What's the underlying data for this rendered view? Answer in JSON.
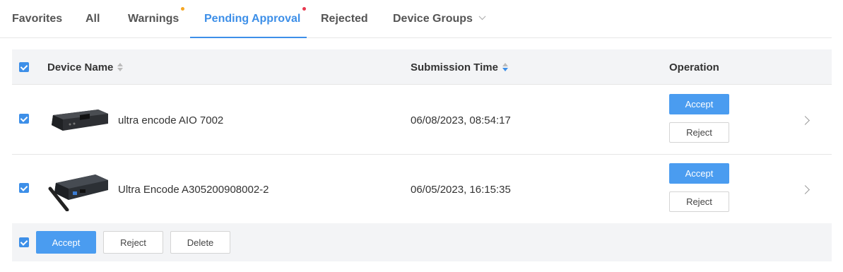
{
  "tabs": [
    {
      "label": "Favorites"
    },
    {
      "label": "All"
    },
    {
      "label": "Warnings"
    },
    {
      "label": "Pending Approval"
    },
    {
      "label": "Rejected"
    },
    {
      "label": "Device Groups"
    }
  ],
  "tab_colors": {
    "active": "#3d8fe8",
    "warning_dot": "#f5a623",
    "pending_dot": "#e8384f"
  },
  "table": {
    "headers": {
      "device_name": "Device Name",
      "submission_time": "Submission Time",
      "operation": "Operation"
    },
    "rows": [
      {
        "device_name": "ultra encode AIO 7002",
        "submission_time": "06/08/2023, 08:54:17",
        "accept": "Accept",
        "reject": "Reject",
        "selected": true
      },
      {
        "device_name": "Ultra Encode A305200908002-2",
        "submission_time": "06/05/2023, 16:15:35",
        "accept": "Accept",
        "reject": "Reject",
        "selected": true
      }
    ]
  },
  "footer": {
    "accept": "Accept",
    "reject": "Reject",
    "delete": "Delete"
  },
  "icons": {
    "sort": "sort-icon",
    "chevron_right": "chevron-right-icon",
    "chevron_down": "chevron-down-icon"
  }
}
